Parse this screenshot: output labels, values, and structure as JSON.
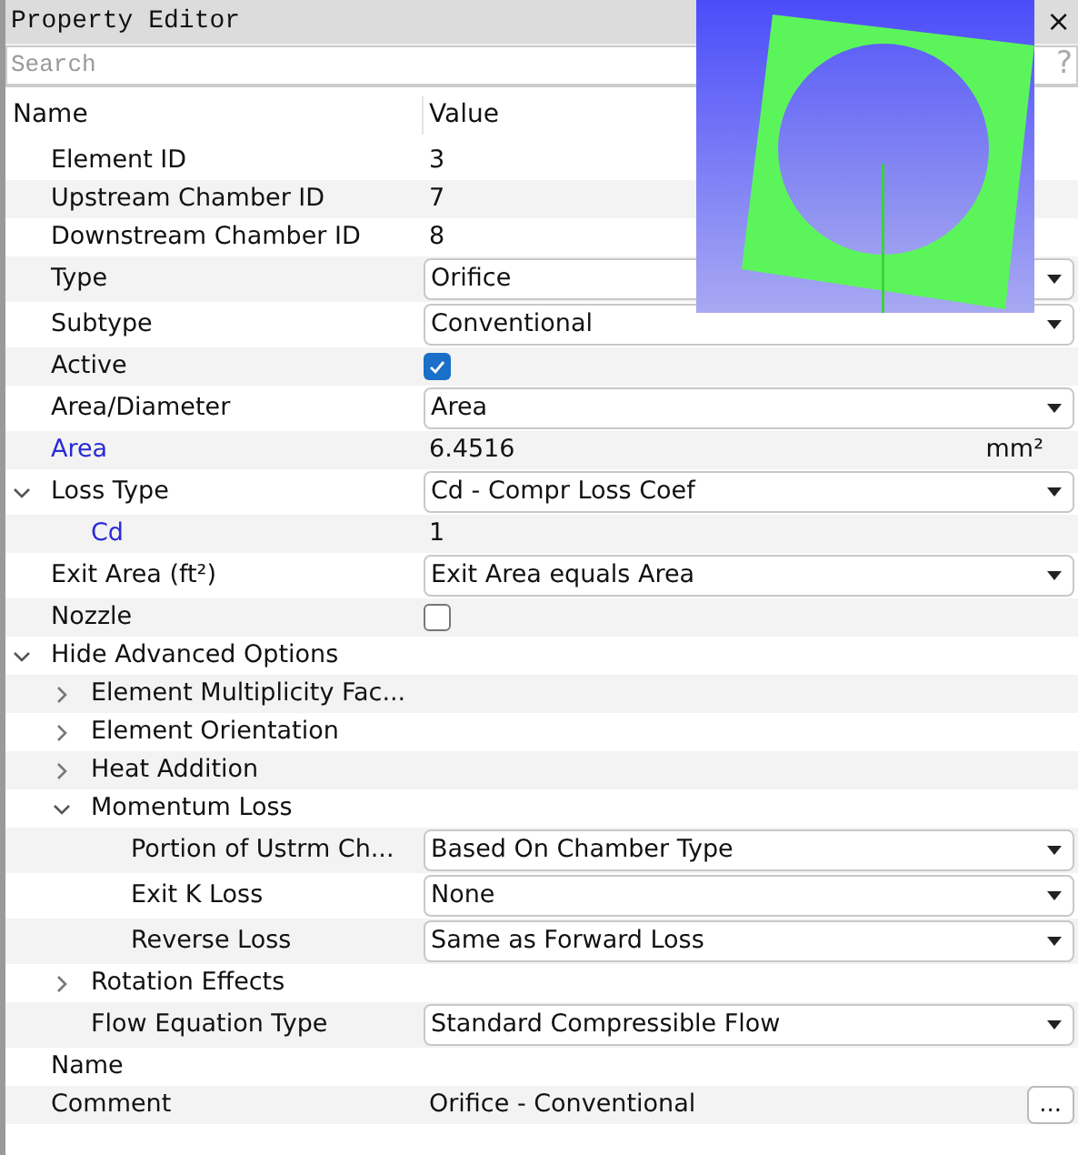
{
  "window": {
    "title": "Property Editor",
    "close": "×"
  },
  "search": {
    "placeholder": "Search",
    "help": "?"
  },
  "columns": [
    "Name",
    "Value"
  ],
  "rows": [
    {
      "name": "Element ID",
      "kind": "text",
      "value": "3"
    },
    {
      "name": "Upstream Chamber ID",
      "kind": "text",
      "value": "7"
    },
    {
      "name": "Downstream Chamber ID",
      "kind": "text",
      "value": "8"
    },
    {
      "name": "Type",
      "kind": "dropdown",
      "value": "Orifice"
    },
    {
      "name": "Subtype",
      "kind": "dropdown",
      "value": "Conventional"
    },
    {
      "name": "Active",
      "kind": "checkbox",
      "checked": true
    },
    {
      "name": "Area/Diameter",
      "kind": "dropdown",
      "value": "Area"
    },
    {
      "name": "Area",
      "kind": "unit",
      "value": "6.4516",
      "unit": "mm²",
      "linked": true
    },
    {
      "name": "Loss Type",
      "kind": "dropdown",
      "value": "Cd - Compr Loss Coef",
      "expanded": true,
      "children": [
        {
          "name": "Cd",
          "kind": "text",
          "value": "1",
          "linked": true
        }
      ]
    },
    {
      "name": "Exit Area (ft²)",
      "kind": "dropdown",
      "value": "Exit Area equals Area"
    },
    {
      "name": "Nozzle",
      "kind": "checkbox",
      "checked": false
    },
    {
      "name": "Hide Advanced Options",
      "kind": "group",
      "expanded": true,
      "children": [
        {
          "name": "Element Multiplicity Fac...",
          "kind": "group",
          "expanded": false
        },
        {
          "name": "Element Orientation",
          "kind": "group",
          "expanded": false
        },
        {
          "name": "Heat Addition",
          "kind": "group",
          "expanded": false
        },
        {
          "name": "Momentum Loss",
          "kind": "group",
          "expanded": true,
          "children": [
            {
              "name": "Portion of Ustrm Ch...",
              "kind": "dropdown",
              "value": "Based On Chamber Type"
            },
            {
              "name": "Exit K Loss",
              "kind": "dropdown",
              "value": "None"
            },
            {
              "name": "Reverse Loss",
              "kind": "dropdown",
              "value": "Same as Forward Loss"
            }
          ]
        },
        {
          "name": "Rotation Effects",
          "kind": "group",
          "expanded": false
        },
        {
          "name": "Flow Equation Type",
          "kind": "dropdown",
          "value": "Standard Compressible Flow"
        }
      ]
    },
    {
      "name": "Name",
      "kind": "text",
      "value": ""
    },
    {
      "name": "Comment",
      "kind": "button",
      "value": "Orifice - Conventional",
      "button": "..."
    }
  ]
}
